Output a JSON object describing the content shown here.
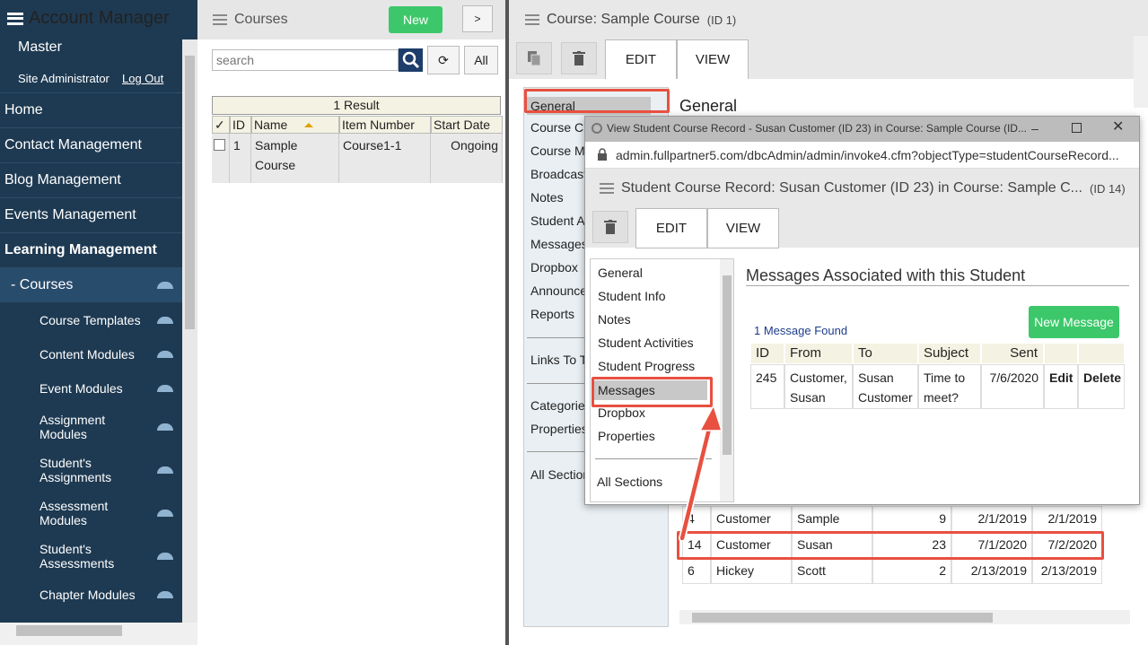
{
  "sidebar": {
    "title": "Account Manager",
    "subtitle": "Master",
    "admin": "Site Administrator",
    "logout": "Log Out",
    "nav": [
      {
        "label": "Home"
      },
      {
        "label": "Contact Management"
      },
      {
        "label": "Blog Management"
      },
      {
        "label": "Events Management"
      },
      {
        "label": "Learning Management"
      }
    ],
    "courses": "-  Courses",
    "subitems": [
      {
        "label": "Course Templates"
      },
      {
        "label": "Content Modules"
      },
      {
        "label": "Event Modules"
      },
      {
        "label": "Assignment Modules"
      },
      {
        "label": "Student's Assignments"
      },
      {
        "label": "Assessment Modules"
      },
      {
        "label": "Student's Assessments"
      },
      {
        "label": "Chapter Modules"
      }
    ]
  },
  "courses": {
    "title": "Courses",
    "new": "New",
    "more": ">",
    "search_placeholder": "search",
    "all": "All",
    "result": "1 Result",
    "headers": [
      "✓",
      "ID",
      "Name",
      "Item Number",
      "Start Date"
    ],
    "row": {
      "id": "1",
      "name": "Sample Course",
      "item": "Course1-1",
      "start": "Ongoing"
    }
  },
  "course_record": {
    "title": "Course: Sample Course",
    "id": "(ID 1)",
    "tabs": [
      "EDIT",
      "VIEW"
    ],
    "nav": [
      "General",
      "Course C",
      "Course M",
      "Broadcast",
      "Notes",
      "Student A",
      "Messages",
      "Dropbox",
      "Announce",
      "Reports",
      "Links To T",
      "Categorie",
      "Properties",
      "All Section"
    ],
    "section": "General",
    "rows": [
      {
        "id": "4",
        "last": "Customer",
        "first": "Sample",
        "sid": "9",
        "d1": "2/1/2019",
        "d2": "2/1/2019"
      },
      {
        "id": "14",
        "last": "Customer",
        "first": "Susan",
        "sid": "23",
        "d1": "7/1/2020",
        "d2": "7/2/2020"
      },
      {
        "id": "6",
        "last": "Hickey",
        "first": "Scott",
        "sid": "2",
        "d1": "2/13/2019",
        "d2": "2/13/2019"
      }
    ]
  },
  "popup": {
    "window_title": "View Student Course Record - Susan Customer (ID 23) in Course: Sample Course (ID...",
    "url": "admin.fullpartner5.com/dbcAdmin/admin/invoke4.cfm?objectType=studentCourseRecord...",
    "title": "Student Course Record: Susan Customer (ID 23) in Course: Sample C...",
    "id": "(ID 14)",
    "tabs": [
      "EDIT",
      "VIEW"
    ],
    "nav": [
      "General",
      "Student Info",
      "Notes",
      "Student Activities",
      "Student Progress",
      "Messages",
      "Dropbox",
      "Properties",
      "All Sections"
    ],
    "heading": "Messages Associated with this Student",
    "found": "1 Message Found",
    "new_message": "New Message",
    "headers": [
      "ID",
      "From",
      "To",
      "Subject",
      "Sent"
    ],
    "row": {
      "id": "245",
      "from": "Customer, Susan",
      "to": "Susan Customer",
      "subject": "Time to meet?",
      "sent": "7/6/2020",
      "edit": "Edit",
      "delete": "Delete"
    }
  }
}
